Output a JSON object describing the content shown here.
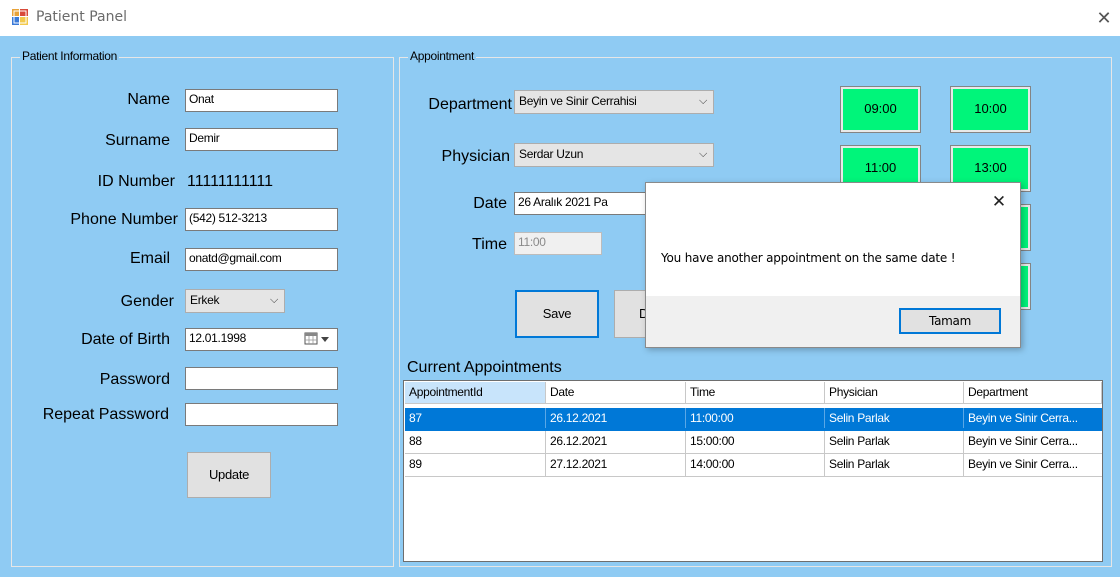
{
  "window": {
    "title": "Patient Panel",
    "close_glyph": "✕"
  },
  "patient_info": {
    "group_title": "Patient Information",
    "name_label": "Name",
    "name_value": "Onat",
    "surname_label": "Surname",
    "surname_value": "Demir",
    "id_label": "ID Number",
    "id_value": "11111111111",
    "phone_label": "Phone Number",
    "phone_value": "(542) 512-3213",
    "email_label": "Email",
    "email_value": "onatd@gmail.com",
    "gender_label": "Gender",
    "gender_value": "Erkek",
    "dob_label": "Date of Birth",
    "dob_value": "12.01.1998",
    "password_label": "Password",
    "password_value": "",
    "repeat_password_label": "Repeat Password",
    "repeat_password_value": "",
    "update_button": "Update"
  },
  "appointment": {
    "group_title": "Appointment",
    "department_label": "Department",
    "department_value": "Beyin ve Sinir Cerrahisi",
    "physician_label": "Physician",
    "physician_value": "Serdar Uzun",
    "date_label": "Date",
    "date_value": "26   Aralık   2021   Pa",
    "time_label": "Time",
    "time_value": "11:00",
    "save_button": "Save",
    "second_button": "D",
    "slots": [
      "09:00",
      "10:00",
      "11:00",
      "13:00"
    ]
  },
  "current_appointments": {
    "title": "Current Appointments",
    "columns": [
      "AppointmentId",
      "Date",
      "Time",
      "Physician",
      "Department"
    ],
    "rows": [
      [
        "87",
        "26.12.2021",
        "11:00:00",
        "Selin Parlak",
        "Beyin ve Sinir Cerra..."
      ],
      [
        "88",
        "26.12.2021",
        "15:00:00",
        "Selin Parlak",
        "Beyin ve Sinir Cerra..."
      ],
      [
        "89",
        "27.12.2021",
        "14:00:00",
        "Selin Parlak",
        "Beyin ve Sinir Cerra..."
      ]
    ],
    "selected_row_color": "#0078d7"
  },
  "dialog": {
    "message": "You have another appointment on the same date !",
    "ok_button": "Tamam",
    "close_glyph": "✕"
  },
  "colors": {
    "background": "#8fcbf3",
    "slot_available": "#00f57a"
  }
}
